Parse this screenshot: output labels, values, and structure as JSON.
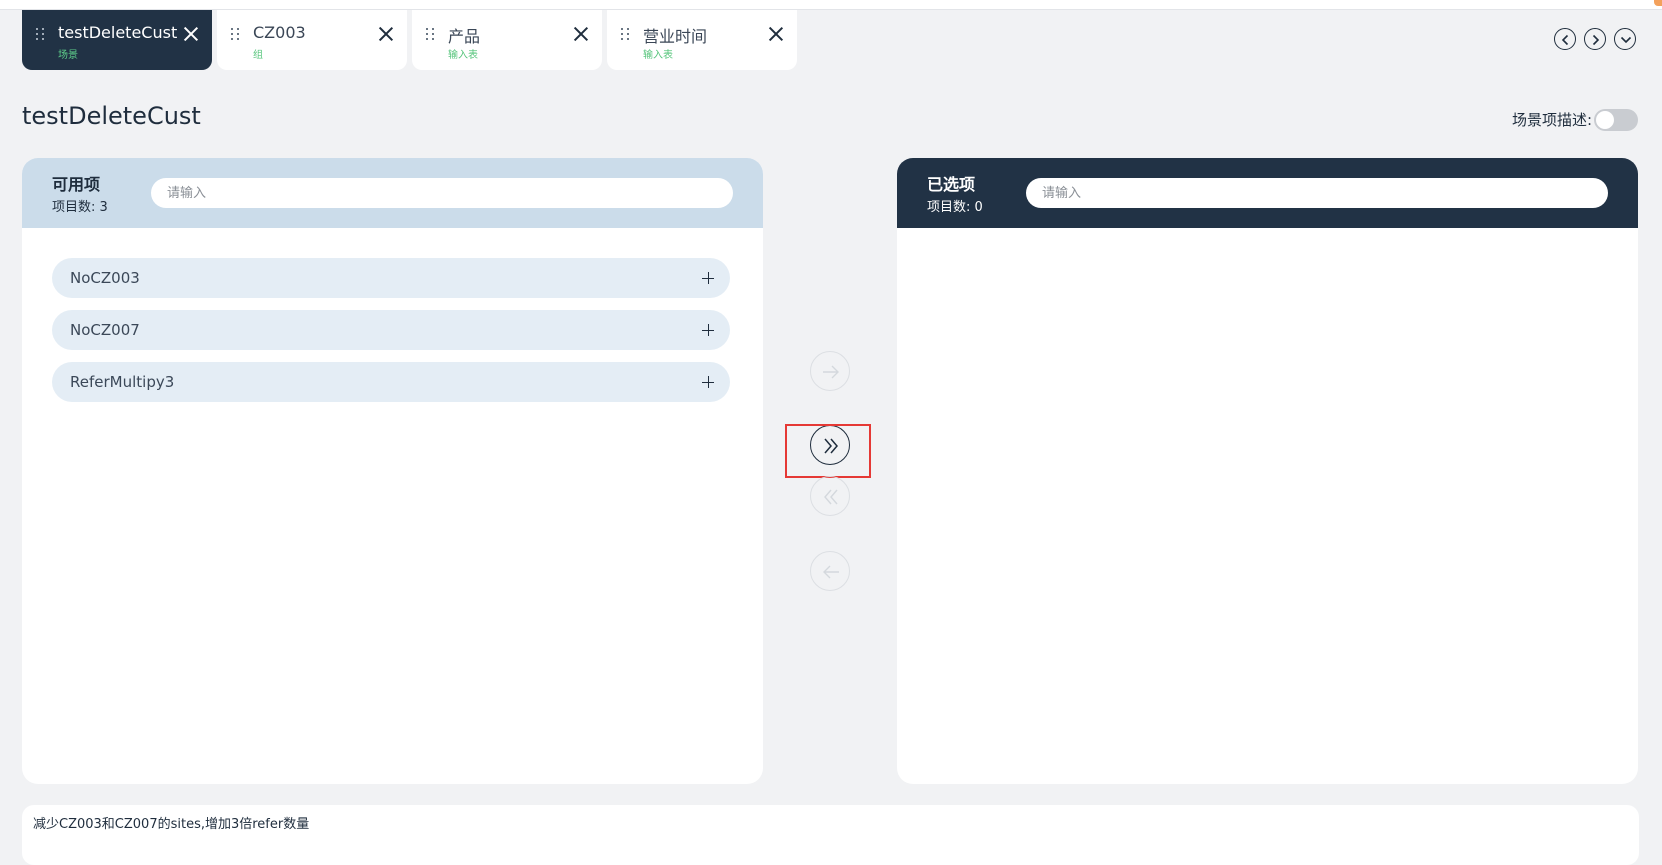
{
  "tabs": [
    {
      "title": "testDeleteCust",
      "subtitle": "场景",
      "active": true
    },
    {
      "title": "CZ003",
      "subtitle": "组",
      "active": false
    },
    {
      "title": "产品",
      "subtitle": "输入表",
      "active": false
    },
    {
      "title": "营业时间",
      "subtitle": "输入表",
      "active": false
    }
  ],
  "nav_icons": [
    "chevron-left-icon",
    "chevron-right-icon",
    "chevron-down-icon"
  ],
  "page": {
    "title": "testDeleteCust",
    "description_label": "场景项描述:",
    "description_toggle_on": false
  },
  "available": {
    "title": "可用项",
    "count_text": "项目数:  3",
    "search_placeholder": "请输入",
    "items": [
      {
        "label": "NoCZ003"
      },
      {
        "label": "NoCZ007"
      },
      {
        "label": "ReferMultipy3"
      }
    ]
  },
  "selected": {
    "title": "已选项",
    "count_text": "项目数:  0",
    "search_placeholder": "请输入",
    "items": []
  },
  "transfer_buttons": [
    {
      "icon": "arrow-right-icon",
      "enabled": false
    },
    {
      "icon": "double-chevron-right-icon",
      "enabled": true
    },
    {
      "icon": "double-chevron-left-icon",
      "enabled": false
    },
    {
      "icon": "arrow-left-icon",
      "enabled": false
    }
  ],
  "note": {
    "text": "减少CZ003和CZ007的sites,增加3倍refer数量"
  },
  "colors": {
    "dark_navy": "#213245",
    "light_blue_header": "#cbdcea",
    "item_bg": "#e4edf5",
    "subtitle_green": "#54c47a",
    "highlight_red": "#e53935",
    "page_bg": "#f1f2f4"
  }
}
